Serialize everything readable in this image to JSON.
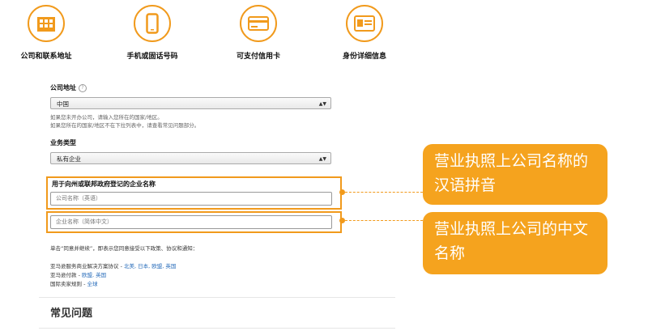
{
  "steps": [
    {
      "label": "公司和联系地址",
      "icon": "building-icon"
    },
    {
      "label": "手机或固话号码",
      "icon": "phone-icon"
    },
    {
      "label": "可支付信用卡",
      "icon": "credit-card-icon"
    },
    {
      "label": "身份详细信息",
      "icon": "id-card-icon"
    }
  ],
  "company_address": {
    "label": "公司地址",
    "selected": "中国",
    "hint_line1": "如果您未开办公司，请输入您所在的国家/地区。",
    "hint_line2": "如果您所在的国家/地区不在下拉列表中，请查看常见问题部分。"
  },
  "business_type": {
    "label": "业务类型",
    "selected": "私有企业"
  },
  "company_name": {
    "label": "用于向州或联邦政府登记的企业名称",
    "placeholder_en": "公司名称（英语）",
    "placeholder_cn": "企业名称（简体中文）"
  },
  "callouts": {
    "pinyin": "营业执照上公司名称的汉语拼音",
    "chinese": "营业执照上公司的中文名称"
  },
  "agreement": {
    "intro": "单击“同意并继续”，即表示您同意接受以下政策、协议和通知：",
    "line1_prefix": "亚马逊服务商业解决方案协议 - ",
    "line1_links": "北美, 日本, 欧盟, 英国",
    "line2_prefix": "亚马逊付款 - ",
    "line2_links": "欧盟, 英国",
    "line3_prefix": "国际卖家规则 - ",
    "line3_links": "全球"
  },
  "faq": {
    "title": "常见问题"
  },
  "colors": {
    "accent": "#f19a1c",
    "callout_bg": "#f5a31e",
    "link": "#2a6ebb"
  }
}
